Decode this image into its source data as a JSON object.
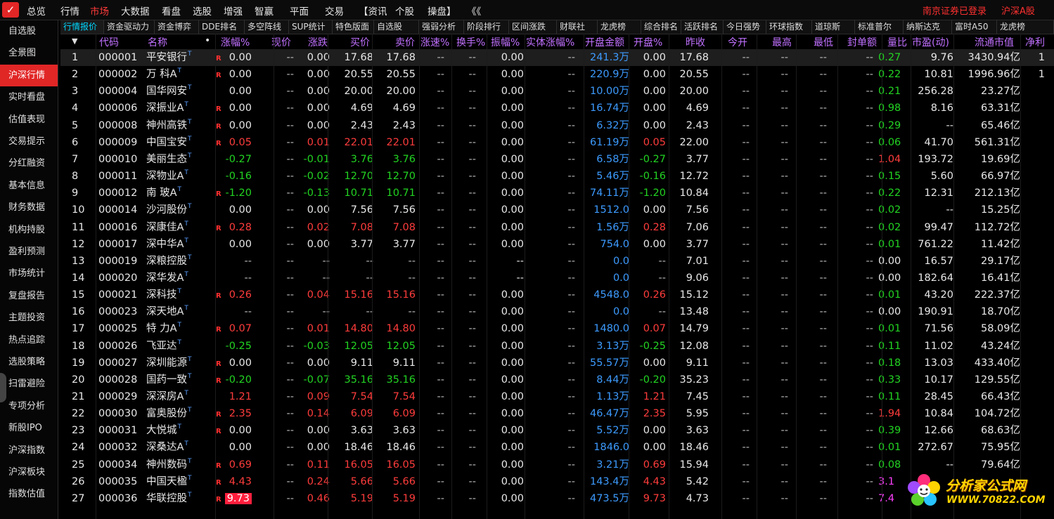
{
  "menu": {
    "items": [
      "总览",
      "行情",
      "市场",
      "大数据",
      "看盘",
      "选股",
      "增强",
      "智赢",
      "平面",
      "交易",
      "【资讯",
      "个股",
      "操盘】",
      "《《"
    ],
    "active_index": 2,
    "status_login": "南京证券已登录",
    "status_market": "沪深A股"
  },
  "sidebar": {
    "items": [
      "自选股",
      "全景图",
      "沪深行情",
      "实时看盘",
      "估值表现",
      "交易提示",
      "分红融资",
      "基本信息",
      "财务数据",
      "机构持股",
      "盈利预测",
      "市场统计",
      "复盘报告",
      "主题投资",
      "热点追踪",
      "选股策略",
      "扫雷避险",
      "专项分析",
      "新股IPO",
      "沪深指数",
      "沪深板块",
      "指数估值"
    ],
    "active_index": 2
  },
  "tabs": {
    "items": [
      "行情报价",
      "资金驱动力",
      "资金博弈",
      "DDE排名",
      "多空阵线",
      "SUP统计",
      "特色版面",
      "自选股",
      "强弱分析",
      "阶段排行",
      "区间涨跌",
      "财联社",
      "龙虎榜",
      "综合排名",
      "活跃排名",
      "今日强势",
      "环球指数",
      "道琼斯",
      "标准普尔",
      "纳斯达克",
      "富时A50",
      "龙虎榜"
    ],
    "active_index": 0
  },
  "table": {
    "headers": [
      "▼",
      "代码",
      "名称",
      "•",
      "涨幅%",
      "现价",
      "涨跌",
      "买价",
      "卖价",
      "涨速%",
      "换手%",
      "振幅%",
      "实体涨幅%",
      "开盘金额",
      "开盘%",
      "昨收",
      "今开",
      "最高",
      "最低",
      "封单额",
      "量比",
      "市盈(动)",
      "流通市值",
      "净利"
    ],
    "rows": [
      {
        "idx": "1",
        "code": "000001",
        "name": "平安银行",
        "sup": "T",
        "mark": "R",
        "pct": "0.00",
        "price": "--",
        "chg": "0.00",
        "bid": "17.68",
        "ask": "17.68",
        "speed": "--",
        "turn": "--",
        "amp": "0.00",
        "body": "--",
        "open_amt": "241.3万",
        "open_pct": "0.00",
        "prev": "17.68",
        "open": "--",
        "high": "--",
        "low": "--",
        "seal": "--",
        "vr": "0.27",
        "pe": "9.76",
        "mcap": "3430.94亿",
        "np": "1",
        "tone": "w",
        "vr_tone": "g"
      },
      {
        "idx": "2",
        "code": "000002",
        "name": "万 科A",
        "sup": "T",
        "mark": "R",
        "pct": "0.00",
        "price": "--",
        "chg": "0.00",
        "bid": "20.55",
        "ask": "20.55",
        "speed": "--",
        "turn": "--",
        "amp": "0.00",
        "body": "--",
        "open_amt": "220.9万",
        "open_pct": "0.00",
        "prev": "20.55",
        "open": "--",
        "high": "--",
        "low": "--",
        "seal": "--",
        "vr": "0.22",
        "pe": "10.81",
        "mcap": "1996.96亿",
        "np": "1",
        "tone": "w",
        "vr_tone": "g"
      },
      {
        "idx": "3",
        "code": "000004",
        "name": "国华网安",
        "sup": "T",
        "mark": "",
        "pct": "0.00",
        "price": "--",
        "chg": "0.00",
        "bid": "20.00",
        "ask": "20.00",
        "speed": "--",
        "turn": "--",
        "amp": "0.00",
        "body": "--",
        "open_amt": "10.00万",
        "open_pct": "0.00",
        "prev": "20.00",
        "open": "--",
        "high": "--",
        "low": "--",
        "seal": "--",
        "vr": "0.21",
        "pe": "256.28",
        "mcap": "23.27亿",
        "np": "",
        "tone": "w",
        "vr_tone": "g"
      },
      {
        "idx": "4",
        "code": "000006",
        "name": "深振业A",
        "sup": "T",
        "mark": "R",
        "pct": "0.00",
        "price": "--",
        "chg": "0.00",
        "bid": "4.69",
        "ask": "4.69",
        "speed": "--",
        "turn": "--",
        "amp": "0.00",
        "body": "--",
        "open_amt": "16.74万",
        "open_pct": "0.00",
        "prev": "4.69",
        "open": "--",
        "high": "--",
        "low": "--",
        "seal": "--",
        "vr": "0.98",
        "pe": "8.16",
        "mcap": "63.31亿",
        "np": "",
        "tone": "w",
        "vr_tone": "g"
      },
      {
        "idx": "5",
        "code": "000008",
        "name": "神州高铁",
        "sup": "T",
        "mark": "R",
        "pct": "0.00",
        "price": "--",
        "chg": "0.00",
        "bid": "2.43",
        "ask": "2.43",
        "speed": "--",
        "turn": "--",
        "amp": "0.00",
        "body": "--",
        "open_amt": "6.32万",
        "open_pct": "0.00",
        "prev": "2.43",
        "open": "--",
        "high": "--",
        "low": "--",
        "seal": "--",
        "vr": "0.29",
        "pe": "--",
        "mcap": "65.46亿",
        "np": "",
        "tone": "w",
        "vr_tone": "g"
      },
      {
        "idx": "6",
        "code": "000009",
        "name": "中国宝安",
        "sup": "T",
        "mark": "R",
        "pct": "0.05",
        "price": "--",
        "chg": "0.01",
        "bid": "22.01",
        "ask": "22.01",
        "speed": "--",
        "turn": "--",
        "amp": "0.00",
        "body": "--",
        "open_amt": "61.19万",
        "open_pct": "0.05",
        "prev": "22.00",
        "open": "--",
        "high": "--",
        "low": "--",
        "seal": "--",
        "vr": "0.06",
        "pe": "41.70",
        "mcap": "561.31亿",
        "np": "",
        "tone": "r",
        "vr_tone": "g"
      },
      {
        "idx": "7",
        "code": "000010",
        "name": "美丽生态",
        "sup": "T",
        "mark": "",
        "pct": "-0.27",
        "price": "--",
        "chg": "-0.01",
        "bid": "3.76",
        "ask": "3.76",
        "speed": "--",
        "turn": "--",
        "amp": "0.00",
        "body": "--",
        "open_amt": "6.58万",
        "open_pct": "-0.27",
        "prev": "3.77",
        "open": "--",
        "high": "--",
        "low": "--",
        "seal": "--",
        "vr": "1.04",
        "pe": "193.72",
        "mcap": "19.69亿",
        "np": "",
        "tone": "g",
        "vr_tone": "r"
      },
      {
        "idx": "8",
        "code": "000011",
        "name": "深物业A",
        "sup": "T",
        "mark": "",
        "pct": "-0.16",
        "price": "--",
        "chg": "-0.02",
        "bid": "12.70",
        "ask": "12.70",
        "speed": "--",
        "turn": "--",
        "amp": "0.00",
        "body": "--",
        "open_amt": "5.46万",
        "open_pct": "-0.16",
        "prev": "12.72",
        "open": "--",
        "high": "--",
        "low": "--",
        "seal": "--",
        "vr": "0.15",
        "pe": "5.60",
        "mcap": "66.97亿",
        "np": "",
        "tone": "g",
        "vr_tone": "g"
      },
      {
        "idx": "9",
        "code": "000012",
        "name": "南 玻A",
        "sup": "T",
        "mark": "R",
        "pct": "-1.20",
        "price": "--",
        "chg": "-0.13",
        "bid": "10.71",
        "ask": "10.71",
        "speed": "--",
        "turn": "--",
        "amp": "0.00",
        "body": "--",
        "open_amt": "74.11万",
        "open_pct": "-1.20",
        "prev": "10.84",
        "open": "--",
        "high": "--",
        "low": "--",
        "seal": "--",
        "vr": "0.22",
        "pe": "12.31",
        "mcap": "212.13亿",
        "np": "",
        "tone": "g",
        "vr_tone": "g"
      },
      {
        "idx": "10",
        "code": "000014",
        "name": "沙河股份",
        "sup": "T",
        "mark": "",
        "pct": "0.00",
        "price": "--",
        "chg": "0.00",
        "bid": "7.56",
        "ask": "7.56",
        "speed": "--",
        "turn": "--",
        "amp": "0.00",
        "body": "--",
        "open_amt": "1512.0",
        "open_pct": "0.00",
        "prev": "7.56",
        "open": "--",
        "high": "--",
        "low": "--",
        "seal": "--",
        "vr": "0.02",
        "pe": "--",
        "mcap": "15.25亿",
        "np": "",
        "tone": "w",
        "vr_tone": "g"
      },
      {
        "idx": "11",
        "code": "000016",
        "name": "深康佳A",
        "sup": "T",
        "mark": "R",
        "pct": "0.28",
        "price": "--",
        "chg": "0.02",
        "bid": "7.08",
        "ask": "7.08",
        "speed": "--",
        "turn": "--",
        "amp": "0.00",
        "body": "--",
        "open_amt": "1.56万",
        "open_pct": "0.28",
        "prev": "7.06",
        "open": "--",
        "high": "--",
        "low": "--",
        "seal": "--",
        "vr": "0.02",
        "pe": "99.47",
        "mcap": "112.72亿",
        "np": "",
        "tone": "r",
        "vr_tone": "g"
      },
      {
        "idx": "12",
        "code": "000017",
        "name": "深中华A",
        "sup": "T",
        "mark": "",
        "pct": "0.00",
        "price": "--",
        "chg": "0.00",
        "bid": "3.77",
        "ask": "3.77",
        "speed": "--",
        "turn": "--",
        "amp": "0.00",
        "body": "--",
        "open_amt": "754.0",
        "open_pct": "0.00",
        "prev": "3.77",
        "open": "--",
        "high": "--",
        "low": "--",
        "seal": "--",
        "vr": "0.01",
        "pe": "761.22",
        "mcap": "11.42亿",
        "np": "",
        "tone": "w",
        "vr_tone": "g"
      },
      {
        "idx": "13",
        "code": "000019",
        "name": "深粮控股",
        "sup": "T",
        "mark": "",
        "pct": "--",
        "price": "--",
        "chg": "--",
        "bid": "--",
        "ask": "--",
        "speed": "--",
        "turn": "--",
        "amp": "--",
        "body": "--",
        "open_amt": "0.0",
        "open_pct": "--",
        "prev": "7.01",
        "open": "--",
        "high": "--",
        "low": "--",
        "seal": "--",
        "vr": "0.00",
        "pe": "16.57",
        "mcap": "29.17亿",
        "np": "",
        "tone": "d",
        "vr_tone": "w"
      },
      {
        "idx": "14",
        "code": "000020",
        "name": "深华发A",
        "sup": "T",
        "mark": "",
        "pct": "--",
        "price": "--",
        "chg": "--",
        "bid": "--",
        "ask": "--",
        "speed": "--",
        "turn": "--",
        "amp": "--",
        "body": "--",
        "open_amt": "0.0",
        "open_pct": "--",
        "prev": "9.06",
        "open": "--",
        "high": "--",
        "low": "--",
        "seal": "--",
        "vr": "0.00",
        "pe": "182.64",
        "mcap": "16.41亿",
        "np": "",
        "tone": "d",
        "vr_tone": "w"
      },
      {
        "idx": "15",
        "code": "000021",
        "name": "深科技",
        "sup": "T",
        "mark": "R",
        "pct": "0.26",
        "price": "--",
        "chg": "0.04",
        "bid": "15.16",
        "ask": "15.16",
        "speed": "--",
        "turn": "--",
        "amp": "0.00",
        "body": "--",
        "open_amt": "4548.0",
        "open_pct": "0.26",
        "prev": "15.12",
        "open": "--",
        "high": "--",
        "low": "--",
        "seal": "--",
        "vr": "0.01",
        "pe": "43.20",
        "mcap": "222.37亿",
        "np": "",
        "tone": "r",
        "vr_tone": "g"
      },
      {
        "idx": "16",
        "code": "000023",
        "name": "深天地A",
        "sup": "T",
        "mark": "",
        "pct": "--",
        "price": "--",
        "chg": "--",
        "bid": "--",
        "ask": "--",
        "speed": "--",
        "turn": "--",
        "amp": "0.00",
        "body": "--",
        "open_amt": "0.0",
        "open_pct": "--",
        "prev": "13.48",
        "open": "--",
        "high": "--",
        "low": "--",
        "seal": "--",
        "vr": "0.00",
        "pe": "190.91",
        "mcap": "18.70亿",
        "np": "",
        "tone": "d",
        "vr_tone": "w"
      },
      {
        "idx": "17",
        "code": "000025",
        "name": "特 力A",
        "sup": "T",
        "mark": "R",
        "pct": "0.07",
        "price": "--",
        "chg": "0.01",
        "bid": "14.80",
        "ask": "14.80",
        "speed": "--",
        "turn": "--",
        "amp": "0.00",
        "body": "--",
        "open_amt": "1480.0",
        "open_pct": "0.07",
        "prev": "14.79",
        "open": "--",
        "high": "--",
        "low": "--",
        "seal": "--",
        "vr": "0.01",
        "pe": "71.56",
        "mcap": "58.09亿",
        "np": "",
        "tone": "r",
        "vr_tone": "g"
      },
      {
        "idx": "18",
        "code": "000026",
        "name": "飞亚达",
        "sup": "T",
        "mark": "",
        "pct": "-0.25",
        "price": "--",
        "chg": "-0.03",
        "bid": "12.05",
        "ask": "12.05",
        "speed": "--",
        "turn": "--",
        "amp": "0.00",
        "body": "--",
        "open_amt": "3.13万",
        "open_pct": "-0.25",
        "prev": "12.08",
        "open": "--",
        "high": "--",
        "low": "--",
        "seal": "--",
        "vr": "0.11",
        "pe": "11.02",
        "mcap": "43.24亿",
        "np": "",
        "tone": "g",
        "vr_tone": "g"
      },
      {
        "idx": "19",
        "code": "000027",
        "name": "深圳能源",
        "sup": "T",
        "mark": "R",
        "pct": "0.00",
        "price": "--",
        "chg": "0.00",
        "bid": "9.11",
        "ask": "9.11",
        "speed": "--",
        "turn": "--",
        "amp": "0.00",
        "body": "--",
        "open_amt": "55.57万",
        "open_pct": "0.00",
        "prev": "9.11",
        "open": "--",
        "high": "--",
        "low": "--",
        "seal": "--",
        "vr": "0.18",
        "pe": "13.03",
        "mcap": "433.40亿",
        "np": "",
        "tone": "w",
        "vr_tone": "g"
      },
      {
        "idx": "20",
        "code": "000028",
        "name": "国药一致",
        "sup": "T",
        "mark": "R",
        "pct": "-0.20",
        "price": "--",
        "chg": "-0.07",
        "bid": "35.16",
        "ask": "35.16",
        "speed": "--",
        "turn": "--",
        "amp": "0.00",
        "body": "--",
        "open_amt": "8.44万",
        "open_pct": "-0.20",
        "prev": "35.23",
        "open": "--",
        "high": "--",
        "low": "--",
        "seal": "--",
        "vr": "0.33",
        "pe": "10.17",
        "mcap": "129.55亿",
        "np": "",
        "tone": "g",
        "vr_tone": "g"
      },
      {
        "idx": "21",
        "code": "000029",
        "name": "深深房A",
        "sup": "T",
        "mark": "",
        "pct": "1.21",
        "price": "--",
        "chg": "0.09",
        "bid": "7.54",
        "ask": "7.54",
        "speed": "--",
        "turn": "--",
        "amp": "0.00",
        "body": "--",
        "open_amt": "1.13万",
        "open_pct": "1.21",
        "prev": "7.45",
        "open": "--",
        "high": "--",
        "low": "--",
        "seal": "--",
        "vr": "0.11",
        "pe": "28.45",
        "mcap": "66.43亿",
        "np": "",
        "tone": "r",
        "vr_tone": "g"
      },
      {
        "idx": "22",
        "code": "000030",
        "name": "富奥股份",
        "sup": "T",
        "mark": "R",
        "pct": "2.35",
        "price": "--",
        "chg": "0.14",
        "bid": "6.09",
        "ask": "6.09",
        "speed": "--",
        "turn": "--",
        "amp": "0.00",
        "body": "--",
        "open_amt": "46.47万",
        "open_pct": "2.35",
        "prev": "5.95",
        "open": "--",
        "high": "--",
        "low": "--",
        "seal": "--",
        "vr": "1.94",
        "pe": "10.84",
        "mcap": "104.72亿",
        "np": "",
        "tone": "r",
        "vr_tone": "r"
      },
      {
        "idx": "23",
        "code": "000031",
        "name": "大悦城",
        "sup": "T",
        "mark": "R",
        "pct": "0.00",
        "price": "--",
        "chg": "0.00",
        "bid": "3.63",
        "ask": "3.63",
        "speed": "--",
        "turn": "--",
        "amp": "0.00",
        "body": "--",
        "open_amt": "5.52万",
        "open_pct": "0.00",
        "prev": "3.63",
        "open": "--",
        "high": "--",
        "low": "--",
        "seal": "--",
        "vr": "0.39",
        "pe": "12.66",
        "mcap": "68.63亿",
        "np": "",
        "tone": "w",
        "vr_tone": "g"
      },
      {
        "idx": "24",
        "code": "000032",
        "name": "深桑达A",
        "sup": "T",
        "mark": "",
        "pct": "0.00",
        "price": "--",
        "chg": "0.00",
        "bid": "18.46",
        "ask": "18.46",
        "speed": "--",
        "turn": "--",
        "amp": "0.00",
        "body": "--",
        "open_amt": "1846.0",
        "open_pct": "0.00",
        "prev": "18.46",
        "open": "--",
        "high": "--",
        "low": "--",
        "seal": "--",
        "vr": "0.01",
        "pe": "272.67",
        "mcap": "75.95亿",
        "np": "",
        "tone": "w",
        "vr_tone": "g"
      },
      {
        "idx": "25",
        "code": "000034",
        "name": "神州数码",
        "sup": "T",
        "mark": "R",
        "pct": "0.69",
        "price": "--",
        "chg": "0.11",
        "bid": "16.05",
        "ask": "16.05",
        "speed": "--",
        "turn": "--",
        "amp": "0.00",
        "body": "--",
        "open_amt": "3.21万",
        "open_pct": "0.69",
        "prev": "15.94",
        "open": "--",
        "high": "--",
        "low": "--",
        "seal": "--",
        "vr": "0.08",
        "pe": "--",
        "mcap": "79.64亿",
        "np": "",
        "tone": "r",
        "vr_tone": "g"
      },
      {
        "idx": "26",
        "code": "000035",
        "name": "中国天楹",
        "sup": "T",
        "mark": "R",
        "pct": "4.43",
        "price": "--",
        "chg": "0.24",
        "bid": "5.66",
        "ask": "5.66",
        "speed": "--",
        "turn": "--",
        "amp": "0.00",
        "body": "--",
        "open_amt": "143.4万",
        "open_pct": "4.43",
        "prev": "5.42",
        "open": "--",
        "high": "--",
        "low": "--",
        "seal": "--",
        "vr": "3.1",
        "pe": "",
        "mcap": "",
        "np": "",
        "tone": "r",
        "vr_tone": "m"
      },
      {
        "idx": "27",
        "code": "000036",
        "name": "华联控股",
        "sup": "T",
        "mark": "R",
        "pct": "9.73",
        "price": "--",
        "chg": "0.46",
        "bid": "5.19",
        "ask": "5.19",
        "speed": "--",
        "turn": "--",
        "amp": "0.00",
        "body": "--",
        "open_amt": "473.5万",
        "open_pct": "9.73",
        "prev": "4.73",
        "open": "--",
        "high": "--",
        "low": "--",
        "seal": "--",
        "vr": "7.4",
        "pe": "",
        "mcap": "",
        "np": "",
        "tone": "r",
        "vr_tone": "m",
        "limit_up": true
      }
    ],
    "selected_index": 0
  },
  "watermark": {
    "title": "分析家公式网",
    "url": "WWW.70822.COM"
  },
  "colors": {
    "accent_red": "#e12626",
    "up": "#ff3c3c",
    "down": "#22d322",
    "amount": "#3d9bff",
    "header": "#c070ff",
    "active_tab": "#00d7ff"
  }
}
